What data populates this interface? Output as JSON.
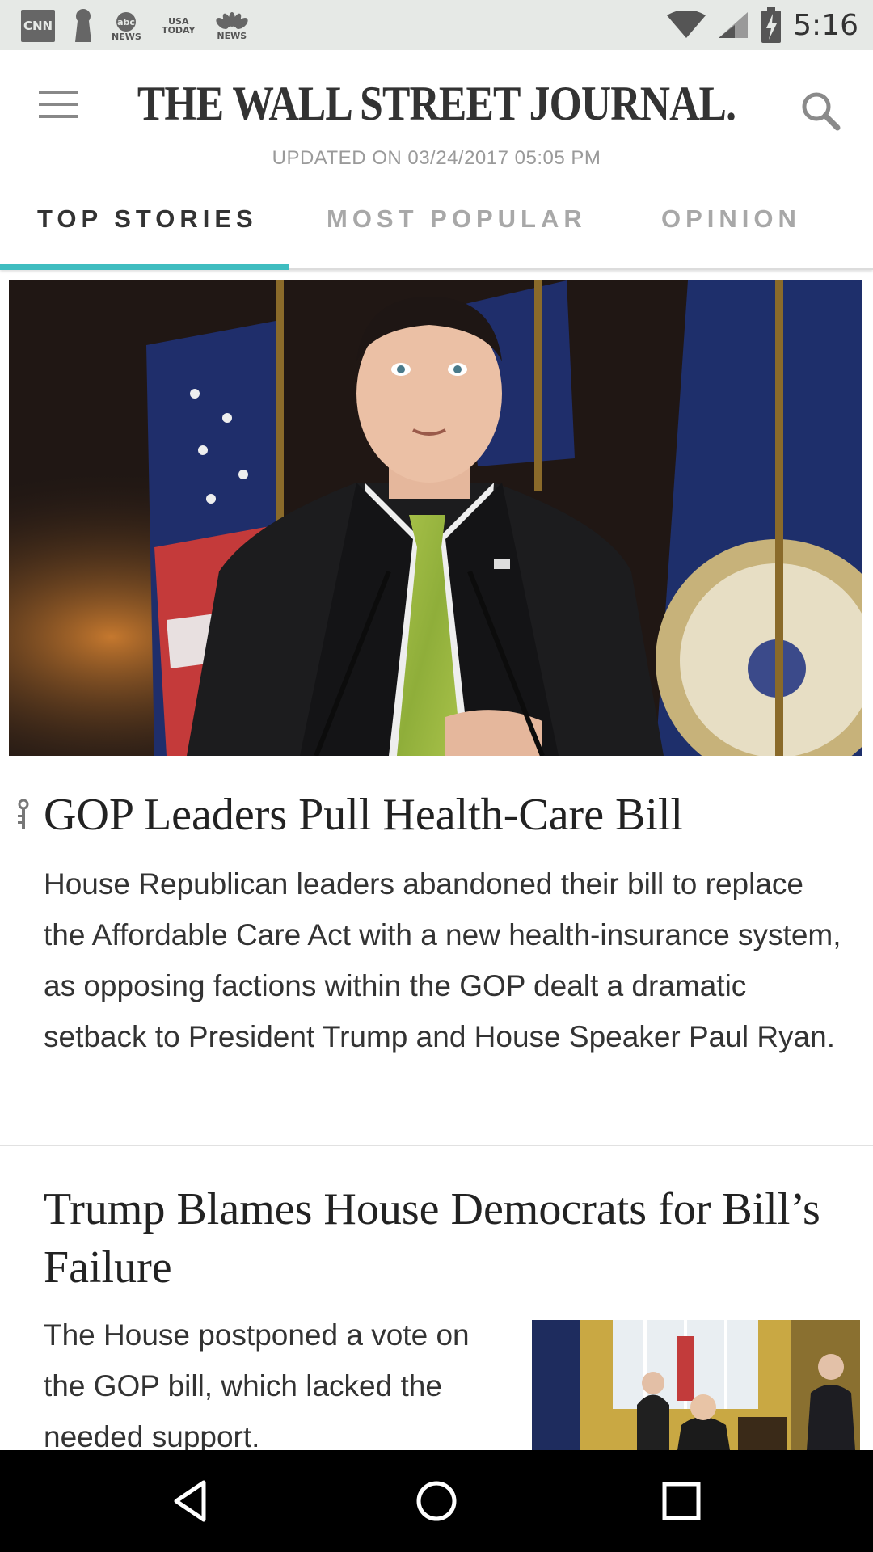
{
  "status_bar": {
    "notification_icons": [
      "cnn-icon",
      "keyhole-icon",
      "abc-news-icon",
      "usa-today-icon",
      "nbc-news-icon"
    ],
    "cnn_label": "CNN",
    "abc_label": "NEWS",
    "usa_today_label": "USA TODAY",
    "nbc_label": "NEWS",
    "time": "5:16"
  },
  "header": {
    "masthead": "THE WALL STREET JOURNAL.",
    "updated": "UPDATED ON 03/24/2017 05:05 PM"
  },
  "tabs": [
    {
      "label": "TOP STORIES",
      "active": true
    },
    {
      "label": "MOST POPULAR",
      "active": false
    },
    {
      "label": "OPINION",
      "active": false
    }
  ],
  "colors": {
    "accent": "#3fbdc0",
    "status_bar_bg": "#e6e9e6",
    "nav_bar_bg": "#000000"
  },
  "stories": [
    {
      "headline": "GOP Leaders Pull Health-Care Bill",
      "summary": "House Republican leaders abandoned their bill to replace the Affordable Care Act with a new health-insurance system, as opposing factions within the GOP dealt a dramatic setback to President Trump and House Speaker Paul Ryan.",
      "has_lock_icon": true
    },
    {
      "headline": "Trump Blames House Democrats for Bill’s Failure",
      "summary": "The House postponed a vote on the GOP bill, which lacked the needed support."
    }
  ]
}
